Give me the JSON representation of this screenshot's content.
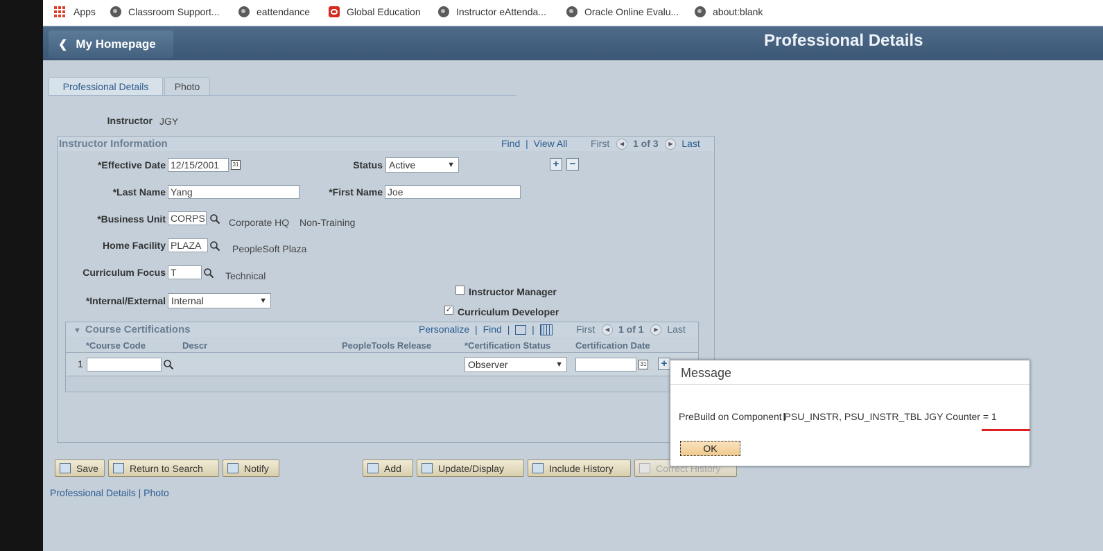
{
  "bookmarks": {
    "items": [
      {
        "label": "Apps",
        "icon": "apps-grid-icon"
      },
      {
        "label": "Classroom Support...",
        "icon": "globe-icon"
      },
      {
        "label": "eattendance",
        "icon": "globe-icon"
      },
      {
        "label": "Global Education",
        "icon": "oracle-icon"
      },
      {
        "label": "Instructor eAttenda...",
        "icon": "globe-icon"
      },
      {
        "label": "Oracle Online Evalu...",
        "icon": "globe-icon"
      },
      {
        "label": "about:blank",
        "icon": "globe-icon"
      }
    ]
  },
  "header": {
    "home_label": "My Homepage",
    "home_icon": "chevron-left-icon",
    "page_title": "Professional Details"
  },
  "tabs": [
    {
      "label": "Professional Details",
      "active": true
    },
    {
      "label": "Photo",
      "active": false
    }
  ],
  "instructor": {
    "label": "Instructor",
    "value": "JGY"
  },
  "instructor_info": {
    "title": "Instructor Information",
    "find": "Find",
    "view_all": "View All",
    "first": "First",
    "count": "1 of 3",
    "last": "Last",
    "effective_date": {
      "label": "*Effective Date",
      "value": "12/15/2001"
    },
    "status": {
      "label": "Status",
      "value": "Active"
    },
    "last_name": {
      "label": "*Last Name",
      "value": "Yang"
    },
    "first_name": {
      "label": "*First Name",
      "value": "Joe"
    },
    "business_unit": {
      "label": "*Business Unit",
      "value": "CORPS",
      "desc1": "Corporate HQ",
      "desc2": "Non-Training"
    },
    "home_facility": {
      "label": "Home Facility",
      "value": "PLAZA",
      "desc": "PeopleSoft Plaza"
    },
    "curriculum_focus": {
      "label": "Curriculum Focus",
      "value": "T",
      "desc": "Technical"
    },
    "internal_external": {
      "label": "*Internal/External",
      "value": "Internal"
    },
    "instructor_manager": {
      "label": "Instructor Manager",
      "checked": false
    },
    "curriculum_developer": {
      "label": "Curriculum Developer",
      "checked": true
    }
  },
  "certifications": {
    "title": "Course Certifications",
    "personalize": "Personalize",
    "find": "Find",
    "first": "First",
    "count": "1 of 1",
    "last": "Last",
    "columns": [
      "*Course Code",
      "Descr",
      "PeopleTools Release",
      "*Certification Status",
      "Certification Date"
    ],
    "rows": [
      {
        "num": "1",
        "course_code": "",
        "descr": "",
        "release": "",
        "status": "Observer",
        "date": ""
      }
    ]
  },
  "toolbar": {
    "save": "Save",
    "return_to_search": "Return to Search",
    "notify": "Notify",
    "add": "Add",
    "update_display": "Update/Display",
    "include_history": "Include History",
    "correct_history": "Correct History"
  },
  "footer_links": {
    "professional_details": "Professional Details",
    "separator": "|",
    "photo": "Photo"
  },
  "message": {
    "title": "Message",
    "text": "PreBuild on Component PSU_INSTR, PSU_INSTR_TBL JGY Counter = 1",
    "ok": "OK"
  },
  "colors": {
    "banner": "#3b5775",
    "page_bg": "#c4cfd9",
    "link": "#2c5d92",
    "annotation": "#e02020"
  }
}
